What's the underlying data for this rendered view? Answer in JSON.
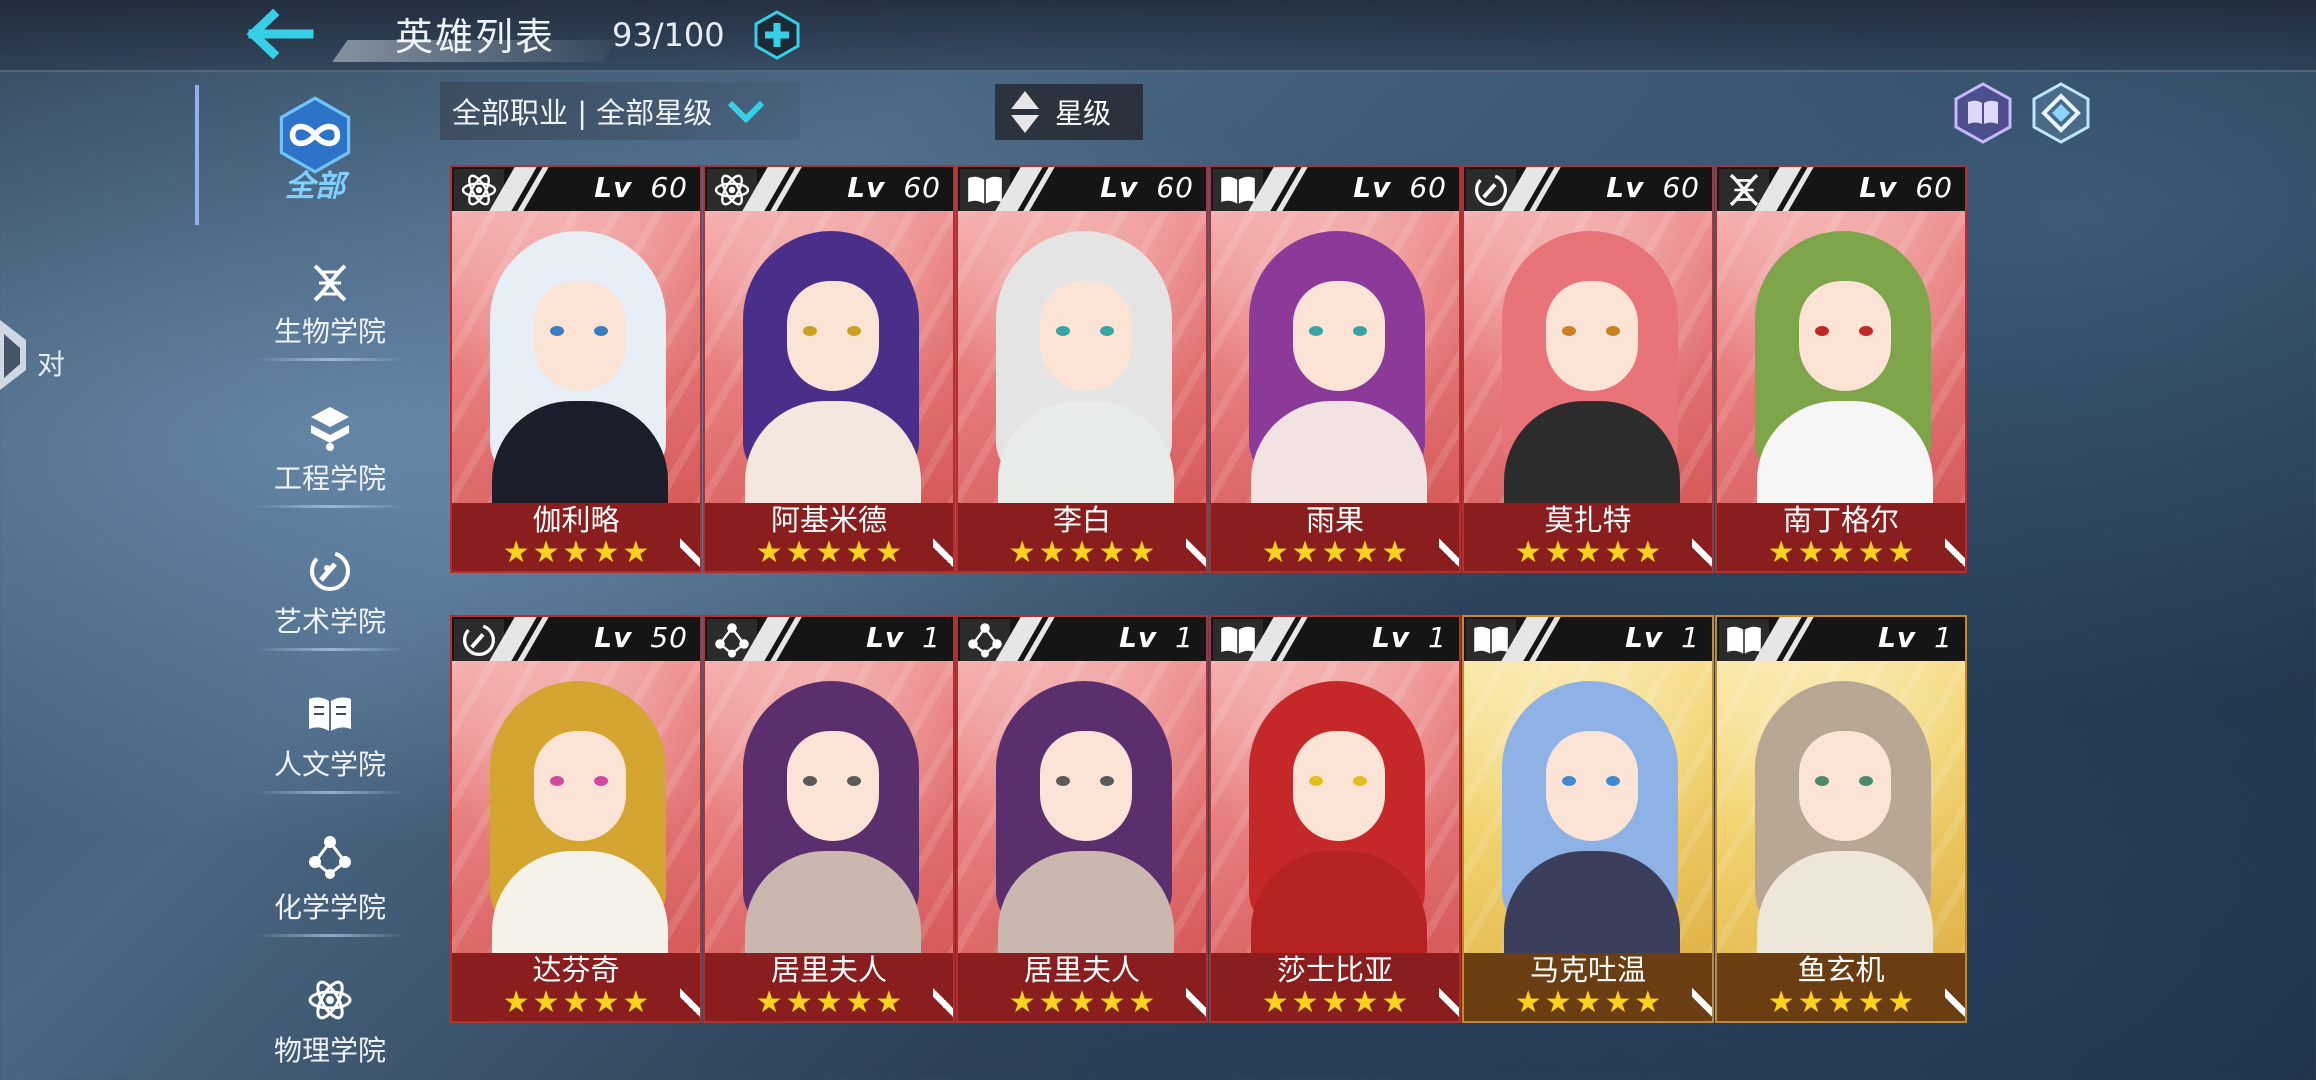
{
  "header": {
    "title": "英雄列表",
    "count": "93/100"
  },
  "sidebar": {
    "all_label": "全部",
    "items": [
      {
        "label": "生物学院",
        "icon": "dna-icon"
      },
      {
        "label": "工程学院",
        "icon": "engineering-icon"
      },
      {
        "label": "艺术学院",
        "icon": "art-icon"
      },
      {
        "label": "人文学院",
        "icon": "book-icon"
      },
      {
        "label": "化学学院",
        "icon": "molecule-icon"
      },
      {
        "label": "物理学院",
        "icon": "atom-icon"
      }
    ]
  },
  "left_edge": {
    "chat_label": "对"
  },
  "filters": {
    "class_filter": "全部职业 | 全部星级",
    "sort_label": "星级"
  },
  "heroes": [
    {
      "name": "伽利略",
      "level": "60",
      "stars": 5,
      "school": "atom-icon",
      "frame": "red"
    },
    {
      "name": "阿基米德",
      "level": "60",
      "stars": 5,
      "school": "atom-icon",
      "frame": "red"
    },
    {
      "name": "李白",
      "level": "60",
      "stars": 5,
      "school": "book-icon",
      "frame": "red"
    },
    {
      "name": "雨果",
      "level": "60",
      "stars": 5,
      "school": "book-icon",
      "frame": "red"
    },
    {
      "name": "莫扎特",
      "level": "60",
      "stars": 5,
      "school": "art-icon",
      "frame": "red"
    },
    {
      "name": "南丁格尔",
      "level": "60",
      "stars": 5,
      "school": "dna-icon",
      "frame": "red"
    },
    {
      "name": "达芬奇",
      "level": "50",
      "stars": 5,
      "school": "art-icon",
      "frame": "red"
    },
    {
      "name": "居里夫人",
      "level": "1",
      "stars": 5,
      "school": "molecule-icon",
      "frame": "red"
    },
    {
      "name": "居里夫人",
      "level": "1",
      "stars": 5,
      "school": "molecule-icon",
      "frame": "red"
    },
    {
      "name": "莎士比亚",
      "level": "1",
      "stars": 5,
      "school": "book-icon",
      "frame": "red"
    },
    {
      "name": "马克吐温",
      "level": "1",
      "stars": 5,
      "school": "book-icon",
      "frame": "gold"
    },
    {
      "name": "鱼玄机",
      "level": "1",
      "stars": 5,
      "school": "book-icon",
      "frame": "gold"
    }
  ],
  "level_prefix": "Lv",
  "colors": {
    "accent_cyan": "#35d0e8",
    "frame_red": "#8a1d1d",
    "frame_gold": "#6b3d12",
    "star": "#ffd21f"
  }
}
